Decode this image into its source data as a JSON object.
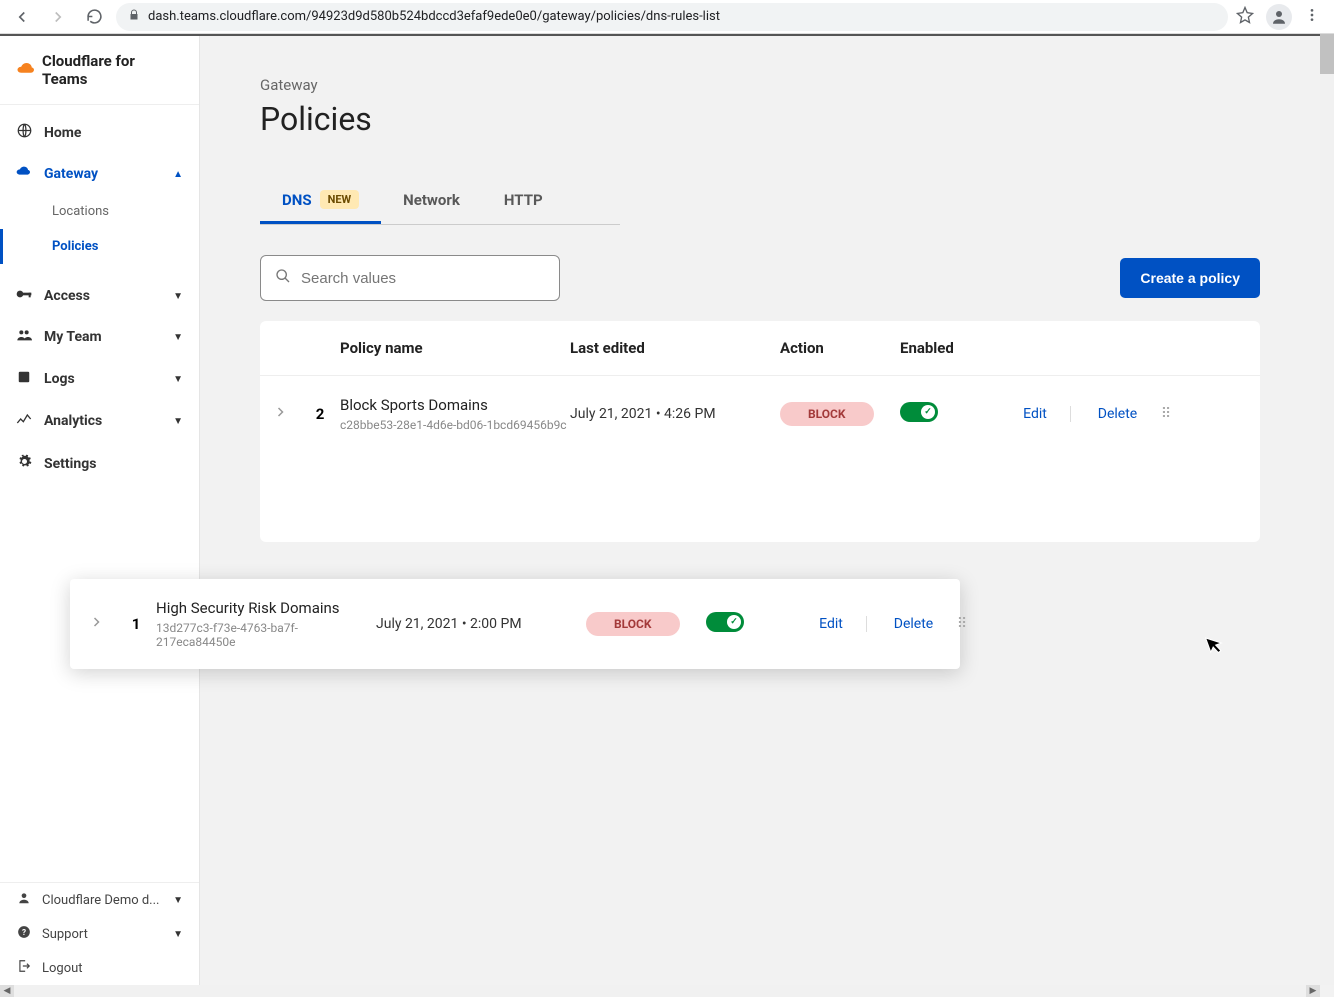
{
  "browser": {
    "url": "dash.teams.cloudflare.com/94923d9d580b524bdccd3efaf9ede0e0/gateway/policies/dns-rules-list"
  },
  "brand": "Cloudflare for Teams",
  "nav": {
    "home": "Home",
    "gateway": "Gateway",
    "locations": "Locations",
    "policies": "Policies",
    "access": "Access",
    "myteam": "My Team",
    "logs": "Logs",
    "analytics": "Analytics",
    "settings": "Settings"
  },
  "footer": {
    "account": "Cloudflare Demo d...",
    "support": "Support",
    "logout": "Logout"
  },
  "breadcrumb": "Gateway",
  "page_title": "Policies",
  "tabs": {
    "dns": "DNS",
    "dns_badge": "NEW",
    "network": "Network",
    "http": "HTTP"
  },
  "search_placeholder": "Search values",
  "create_button": "Create a policy",
  "columns": {
    "name": "Policy name",
    "edited": "Last edited",
    "action": "Action",
    "enabled": "Enabled"
  },
  "row1": {
    "order": "2",
    "name": "Block Sports Domains",
    "id": "c28bbe53-28e1-4d6e-bd06-1bcd69456b9c",
    "edited": "July 21, 2021 • 4:26 PM",
    "action": "BLOCK",
    "edit": "Edit",
    "delete": "Delete"
  },
  "row2": {
    "order": "1",
    "name": "High Security Risk Domains",
    "id": "13d277c3-f73e-4763-ba7f-217eca84450e",
    "edited": "July 21, 2021 • 2:00 PM",
    "action": "BLOCK",
    "edit": "Edit",
    "delete": "Delete"
  }
}
